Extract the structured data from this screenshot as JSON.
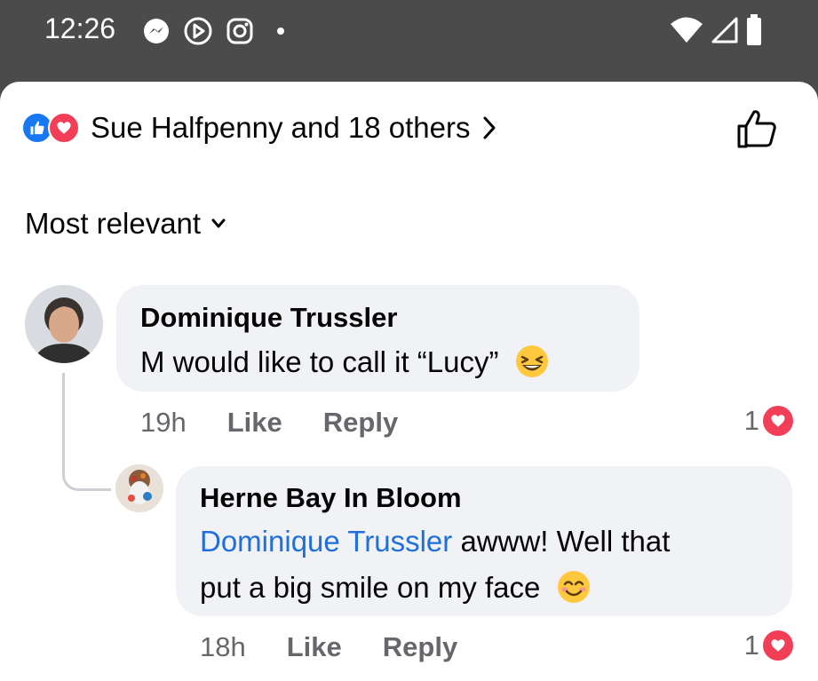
{
  "status_bar": {
    "time": "12:26"
  },
  "reactions": {
    "summary": "Sue Halfpenny and 18 others"
  },
  "sort": {
    "label": "Most relevant"
  },
  "comments": [
    {
      "author": "Dominique Trussler",
      "text": "M would like to call it “Lucy”",
      "emoji": "laughing-emoji",
      "time": "19h",
      "like_label": "Like",
      "reply_label": "Reply",
      "reaction_count": "1"
    }
  ],
  "reply": {
    "author": "Herne Bay In Bloom",
    "mention": "Dominique Trussler",
    "text_line1": " awww! Well that",
    "text_line2": "put a big smile on my face",
    "emoji": "smiling-emoji",
    "time": "18h",
    "like_label": "Like",
    "reply_label": "Reply",
    "reaction_count": "1"
  },
  "colors": {
    "like_blue": "#1877f2",
    "love_red": "#f33e58",
    "mention_blue": "#216fdb",
    "bubble_gray": "#f0f2f5",
    "meta_gray": "#65676b"
  }
}
